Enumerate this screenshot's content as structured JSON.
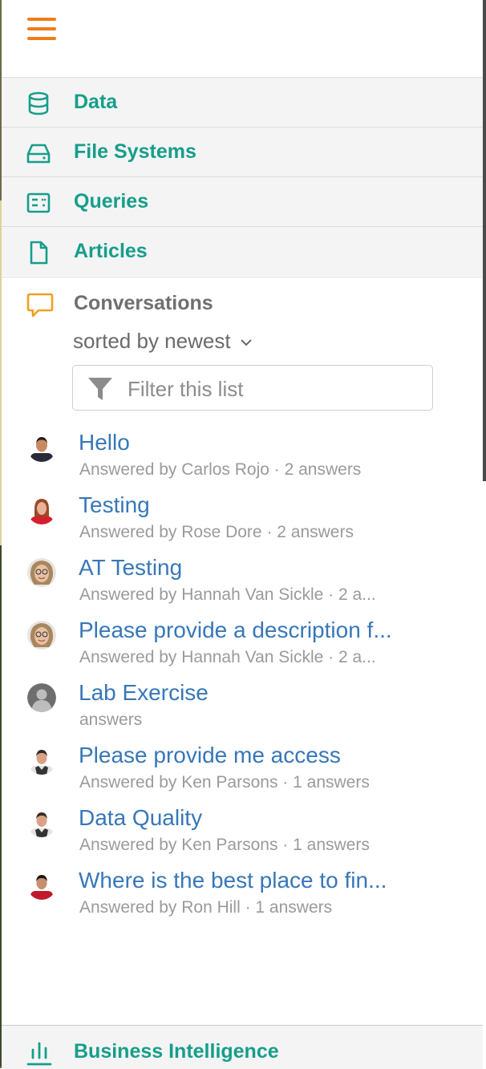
{
  "colors": {
    "accent_orange": "#f07d19",
    "nav_teal": "#169e8a",
    "link_blue": "#3777b8",
    "meta_gray": "#9a9a9a"
  },
  "header": {
    "menu_icon": "hamburger-menu-icon"
  },
  "nav": {
    "items": [
      {
        "label": "Data",
        "icon": "database-icon"
      },
      {
        "label": "File Systems",
        "icon": "hard-drive-icon"
      },
      {
        "label": "Queries",
        "icon": "query-list-icon"
      },
      {
        "label": "Articles",
        "icon": "document-icon"
      }
    ]
  },
  "conversations": {
    "title": "Conversations",
    "icon": "speech-bubble-icon",
    "sort_label": "sorted by newest",
    "filter_placeholder": "Filter this list",
    "items": [
      {
        "question": "Hello",
        "meta": "Answered by Carlos Rojo · 2 answers",
        "avatar": "man-dark-hair"
      },
      {
        "question": "Testing",
        "meta": "Answered by Rose Dore · 2 answers",
        "avatar": "woman-red-hair"
      },
      {
        "question": "AT Testing",
        "meta": "Answered by Hannah Van Sickle · 2 a...",
        "avatar": "woman-glasses"
      },
      {
        "question": "Please provide a description f...",
        "meta": "Answered by Hannah Van Sickle · 2 a...",
        "avatar": "woman-glasses"
      },
      {
        "question": "Lab Exercise",
        "meta": "answers",
        "avatar": "default-user"
      },
      {
        "question": "Please provide me access",
        "meta": "Answered by Ken Parsons · 1 answers",
        "avatar": "man-white-shirt"
      },
      {
        "question": "Data Quality",
        "meta": "Answered by Ken Parsons · 1 answers",
        "avatar": "man-white-shirt"
      },
      {
        "question": "Where is the best place to fin...",
        "meta": "Answered by Ron Hill · 1 answers",
        "avatar": "man-red-shirt"
      }
    ]
  },
  "bottom_nav": {
    "label": "Business Intelligence",
    "icon": "bar-chart-icon"
  }
}
